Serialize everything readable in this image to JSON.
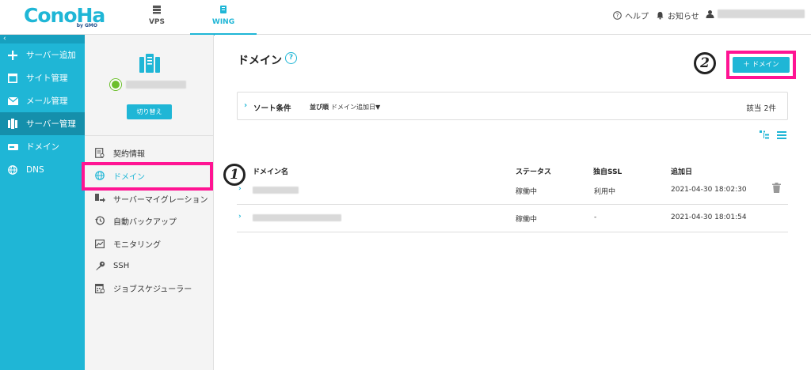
{
  "header": {
    "logo": {
      "main": "ConoHa",
      "sub": "by GMO"
    },
    "tabs": [
      {
        "label": "VPS",
        "icon": "server-stack-icon",
        "active": false
      },
      {
        "label": "WING",
        "icon": "wing-server-icon",
        "active": true
      }
    ],
    "help": "ヘルプ",
    "notice": "お知らせ"
  },
  "sidebar": {
    "collapse": "‹",
    "items": [
      {
        "label": "サーバー追加",
        "icon": "plus-icon"
      },
      {
        "label": "サイト管理",
        "icon": "window-icon"
      },
      {
        "label": "メール管理",
        "icon": "mail-icon"
      },
      {
        "label": "サーバー管理",
        "icon": "server-icon",
        "active": true
      },
      {
        "label": "ドメイン",
        "icon": "domain-icon"
      },
      {
        "label": "DNS",
        "icon": "globe-icon"
      }
    ]
  },
  "subnav": {
    "switch_button": "切り替え",
    "items": [
      {
        "label": "契約情報",
        "icon": "contract-icon"
      },
      {
        "label": "ドメイン",
        "icon": "globe-icon",
        "active": true
      },
      {
        "label": "サーバーマイグレーション",
        "icon": "migration-icon"
      },
      {
        "label": "自動バックアップ",
        "icon": "backup-icon"
      },
      {
        "label": "モニタリング",
        "icon": "monitoring-icon"
      },
      {
        "label": "SSH",
        "icon": "key-icon"
      },
      {
        "label": "ジョブスケジューラー",
        "icon": "calendar-icon"
      }
    ]
  },
  "main": {
    "title": "ドメイン",
    "help_icon": "?",
    "add_button": "＋ ドメイン",
    "sort": {
      "label": "ソート条件",
      "order_label": "並び順",
      "order_value": "ドメイン追加日▼",
      "count": "該当 2件"
    },
    "table": {
      "headers": [
        "ドメイン名",
        "ステータス",
        "独自SSL",
        "追加日"
      ],
      "rows": [
        {
          "status": "稼働中",
          "ssl": "利用中",
          "date": "2021-04-30 18:02:30"
        },
        {
          "status": "稼働中",
          "ssl": "-",
          "date": "2021-04-30 18:01:54"
        }
      ]
    }
  },
  "annotations": {
    "marker1": "1",
    "marker2": "2"
  },
  "colors": {
    "accent": "#1fb6d6",
    "highlight": "#ff1493",
    "status_ok": "#6cbf2c"
  }
}
